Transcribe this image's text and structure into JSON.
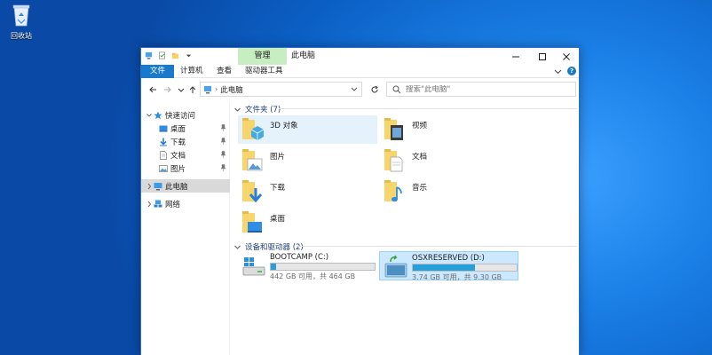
{
  "desktop": {
    "recycle_bin_label": "回收站"
  },
  "window": {
    "context_tab": "管理",
    "title": "此电脑",
    "ribbon_tabs": [
      "文件",
      "计算机",
      "查看",
      "驱动器工具"
    ]
  },
  "address": {
    "path": "此电脑"
  },
  "search": {
    "placeholder": "搜索\"此电脑\""
  },
  "nav_pane": {
    "quick_access": "快速访问",
    "pinned": [
      "桌面",
      "下载",
      "文档",
      "图片"
    ],
    "this_pc": "此电脑",
    "network": "网络"
  },
  "content": {
    "folders_header": "文件夹 (7)",
    "folders": [
      "3D 对象",
      "视频",
      "图片",
      "文档",
      "下载",
      "音乐",
      "桌面"
    ],
    "devices_header": "设备和驱动器 (2)",
    "drives": [
      {
        "name": "BOOTCAMP (C:)",
        "free_text": "442 GB 可用，共 464 GB",
        "used_fraction": 0.05
      },
      {
        "name": "OSXRESERVED (D:)",
        "free_text": "3.74 GB 可用，共 9.30 GB",
        "used_fraction": 0.6
      }
    ]
  },
  "colors": {
    "accent": "#1979ca",
    "context_tab": "#c7eec0",
    "drive_bar": "#26a0da",
    "selection": "#cce8ff"
  }
}
